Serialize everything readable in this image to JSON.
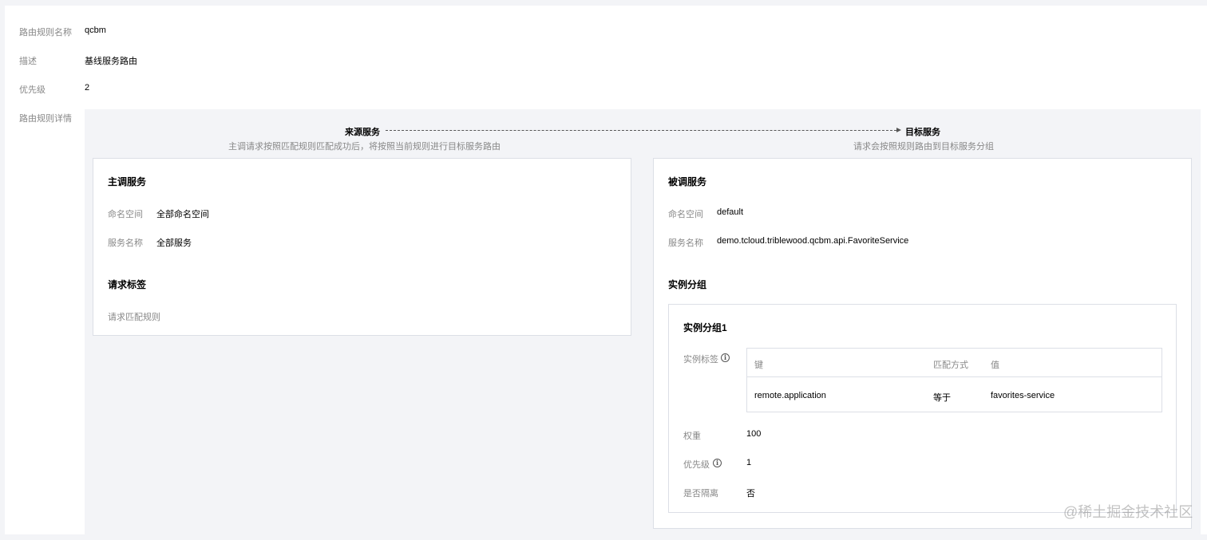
{
  "basic": {
    "name_label": "路由规则名称",
    "name_value": "qcbm",
    "desc_label": "描述",
    "desc_value": "基线服务路由",
    "priority_label": "优先级",
    "priority_value": "2",
    "detail_label": "路由规则详情"
  },
  "flow": {
    "source_title": "来源服务",
    "source_desc": "主调请求按照匹配规则匹配成功后，将按照当前规则进行目标服务路由",
    "target_title": "目标服务",
    "target_desc": "请求会按照规则路由到目标服务分组"
  },
  "caller": {
    "title": "主调服务",
    "namespace_label": "命名空间",
    "namespace_value": "全部命名空间",
    "service_label": "服务名称",
    "service_value": "全部服务",
    "tags_title": "请求标签",
    "tags_label": "请求匹配规则"
  },
  "callee": {
    "title": "被调服务",
    "namespace_label": "命名空间",
    "namespace_value": "default",
    "service_label": "服务名称",
    "service_value": "demo.tcloud.triblewood.qcbm.api.FavoriteService",
    "groups_title": "实例分组"
  },
  "group": {
    "title": "实例分组1",
    "tags_label": "实例标签",
    "columns": [
      "键",
      "匹配方式",
      "值"
    ],
    "rows": [
      [
        "remote.application",
        "等于",
        "favorites-service"
      ]
    ],
    "weight_label": "权重",
    "weight_value": "100",
    "priority_label": "优先级",
    "priority_value": "1",
    "isolate_label": "是否隔离",
    "isolate_value": "否"
  },
  "icons": {
    "info": "info-icon",
    "arrow": "arrow-right-icon"
  },
  "watermark": "@稀土掘金技术社区",
  "colors": {
    "background": "#f3f4f7",
    "border": "#dcdfe6",
    "label": "#888888"
  }
}
